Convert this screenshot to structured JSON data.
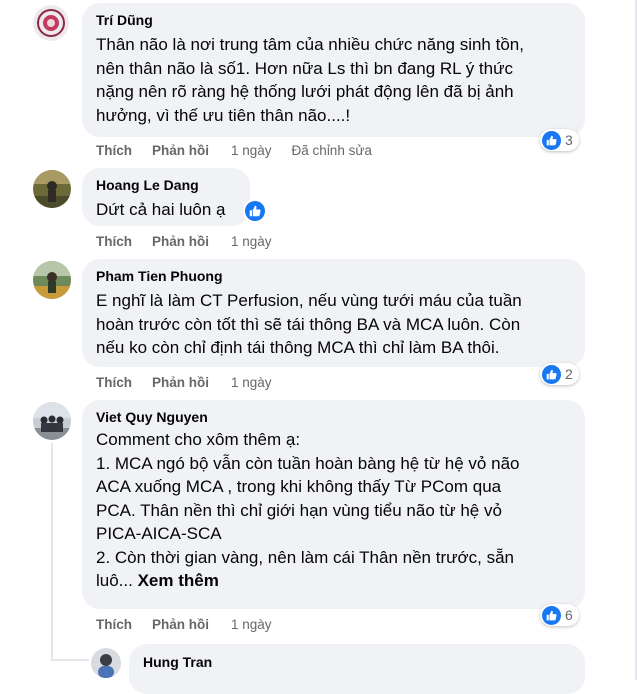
{
  "colors": {
    "bubble": "#f0f2f5",
    "like_blue": "#1877f2",
    "meta_gray": "#65676b"
  },
  "icons": {
    "like": "like-thumb-icon"
  },
  "comments": [
    {
      "author": "Trí Dũng",
      "text": "Thân não là nơi trung tâm của nhiều chức năng sinh tồn,\nnên thân não là số1. Hơn nữa Ls thì bn đang RL ý thức\nnặng nên rõ ràng hệ thống lưới phát động lên đã bị ảnh\nhưởng, vì thế ưu tiên thân não....!",
      "like_label": "Thích",
      "reply_label": "Phản hồi",
      "time": "1 ngày",
      "edited": "Đã chỉnh sửa",
      "reaction_count": "3"
    },
    {
      "author": "Hoang Le Dang",
      "text": "Dứt cả hai luôn ạ",
      "like_label": "Thích",
      "reply_label": "Phản hồi",
      "time": "1 ngày"
    },
    {
      "author": "Pham Tien Phuong",
      "text": "E nghĩ là làm CT Perfusion, nếu vùng tưới máu của tuần\nhoàn trước còn tốt thì sẽ tái thông BA và MCA luôn. Còn\nnếu ko còn chỉ định tái thông MCA thì chỉ làm BA thôi.",
      "like_label": "Thích",
      "reply_label": "Phản hồi",
      "time": "1 ngày",
      "reaction_count": "2"
    },
    {
      "author": "Viet Quy Nguyen",
      "text": "Comment cho xôm thêm ạ:\n1. MCA ngó bộ vẫn còn tuần hoàn bàng hệ từ hệ vỏ não\nACA xuống MCA , trong khi không thấy Từ PCom qua\nPCA. Thân nền thì chỉ giới hạn vùng tiểu não từ hệ vỏ\nPICA-AICA-SCA\n2. Còn thời gian vàng, nên làm cái Thân nền trước, sẵn\nluô...",
      "see_more": "Xem thêm",
      "like_label": "Thích",
      "reply_label": "Phản hồi",
      "time": "1 ngày",
      "reaction_count": "6"
    },
    {
      "author": "Hung Tran"
    }
  ]
}
